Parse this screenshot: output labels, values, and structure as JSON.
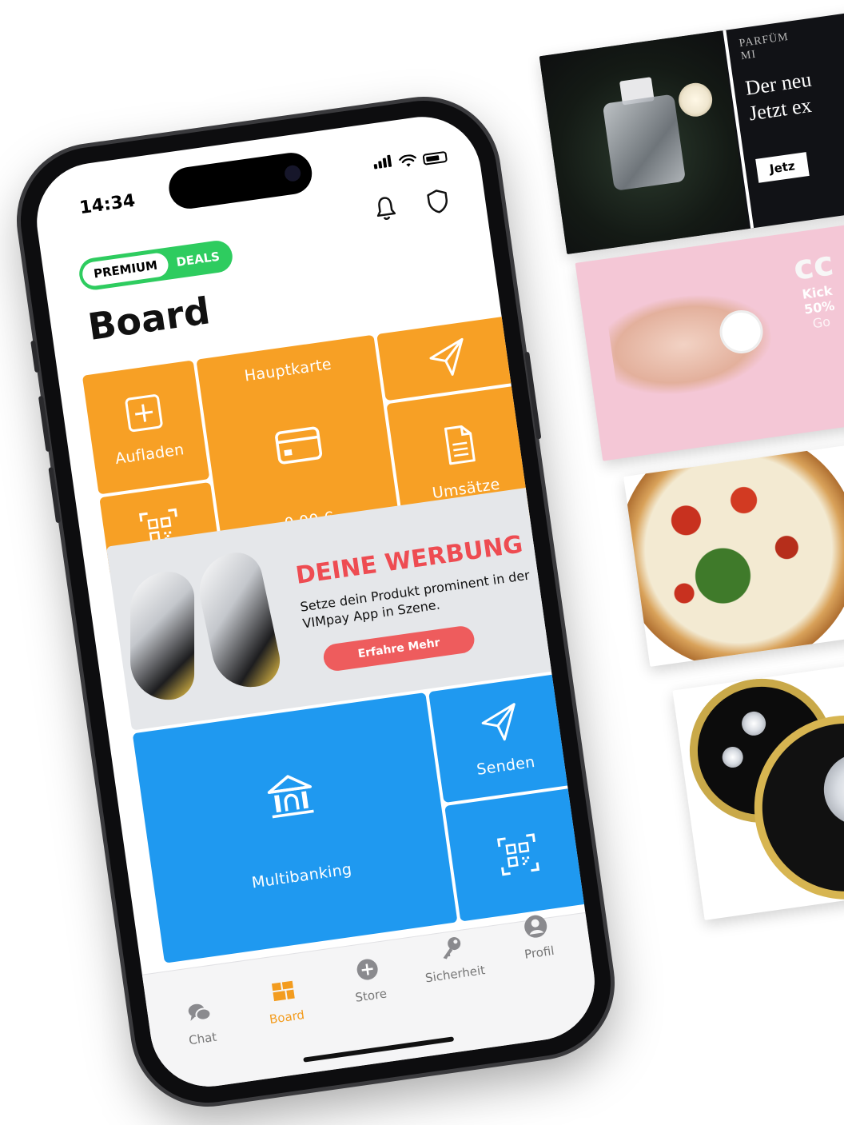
{
  "status": {
    "time": "14:34"
  },
  "header": {
    "toggle": {
      "premium_label": "PREMIUM",
      "deals_label": "DEALS"
    },
    "title": "Board",
    "icons": [
      "bell-icon",
      "shield-icon"
    ]
  },
  "tiles": {
    "aufladen": {
      "label": "Aufladen",
      "icon": "plus-square-icon"
    },
    "hauptkarte": {
      "title": "Hauptkarte",
      "balance": "0,00 €",
      "icon": "credit-card-icon"
    },
    "send_orange": {
      "icon": "paper-plane-icon"
    },
    "umsaetze": {
      "label": "Umsätze",
      "icon": "document-icon"
    },
    "qr_orange": {
      "icon": "qr-code-icon"
    },
    "multibanking": {
      "label": "Multibanking",
      "icon": "bank-icon"
    },
    "senden": {
      "label": "Senden",
      "icon": "paper-plane-icon"
    },
    "qr_blue": {
      "icon": "qr-code-icon"
    }
  },
  "ad": {
    "headline": "DEINE WERBUNG",
    "subtext": "Setze dein Produkt prominent in der VIMpay App in Szene.",
    "cta": "Erfahre Mehr"
  },
  "tabbar": {
    "items": [
      {
        "label": "Chat",
        "icon": "chat-bubbles-icon",
        "active": false
      },
      {
        "label": "Board",
        "icon": "board-grid-icon",
        "active": true
      },
      {
        "label": "Store",
        "icon": "plus-circle-icon",
        "active": false
      },
      {
        "label": "Sicherheit",
        "icon": "key-icon",
        "active": false
      },
      {
        "label": "Profil",
        "icon": "user-icon",
        "active": false
      }
    ]
  },
  "promos": {
    "perfume": {
      "top": "PARFÜM",
      "top2": "MI",
      "line1": "Der neu",
      "line2": "Jetzt ex",
      "button": "Jetz"
    },
    "cosmetic": {
      "logo": "cc",
      "line1": "Kick",
      "line2": "50%",
      "line3": "Go"
    }
  },
  "colors": {
    "orange": "#f7a025",
    "blue": "#1f99f0",
    "green": "#2ecc5f",
    "ad_red": "#ee4c52"
  }
}
